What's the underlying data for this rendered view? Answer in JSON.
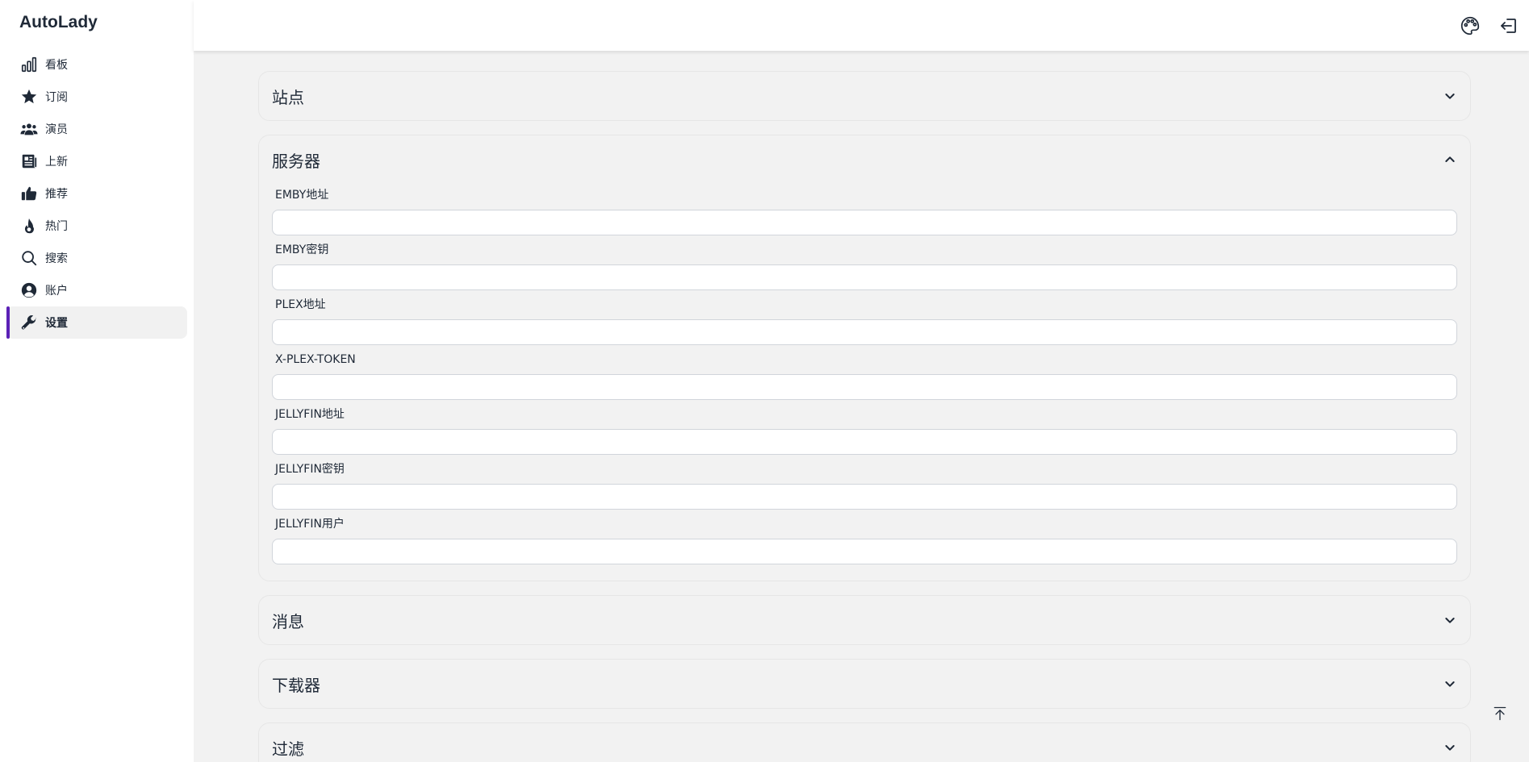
{
  "app": {
    "brand": "AutoLady"
  },
  "sidebar": {
    "items": [
      {
        "label": "看板",
        "icon": "chart-bar-icon",
        "active": false
      },
      {
        "label": "订阅",
        "icon": "star-icon",
        "active": false
      },
      {
        "label": "演员",
        "icon": "users-icon",
        "active": false
      },
      {
        "label": "上新",
        "icon": "newspaper-icon",
        "active": false
      },
      {
        "label": "推荐",
        "icon": "thumbs-up-icon",
        "active": false
      },
      {
        "label": "热门",
        "icon": "fire-icon",
        "active": false
      },
      {
        "label": "搜索",
        "icon": "search-icon",
        "active": false
      },
      {
        "label": "账户",
        "icon": "user-circle-icon",
        "active": false
      },
      {
        "label": "设置",
        "icon": "wrench-icon",
        "active": true
      }
    ]
  },
  "topbar": {
    "icons": [
      "palette-icon",
      "logout-icon"
    ]
  },
  "panels": {
    "site": {
      "title": "站点",
      "expanded": false
    },
    "server": {
      "title": "服务器",
      "expanded": true,
      "fields": [
        {
          "label": "EMBY地址",
          "value": ""
        },
        {
          "label": "EMBY密钥",
          "value": ""
        },
        {
          "label": "PLEX地址",
          "value": ""
        },
        {
          "label": "X-PLEX-TOKEN",
          "value": ""
        },
        {
          "label": "JELLYFIN地址",
          "value": ""
        },
        {
          "label": "JELLYFIN密钥",
          "value": ""
        },
        {
          "label": "JELLYFIN用户",
          "value": ""
        }
      ]
    },
    "message": {
      "title": "消息",
      "expanded": false
    },
    "downloader": {
      "title": "下载器",
      "expanded": false
    },
    "filter": {
      "title": "过滤",
      "expanded": false
    }
  },
  "colors": {
    "accent": "#5b21b6",
    "background": "#f2f2f2",
    "text": "#1f2937"
  }
}
